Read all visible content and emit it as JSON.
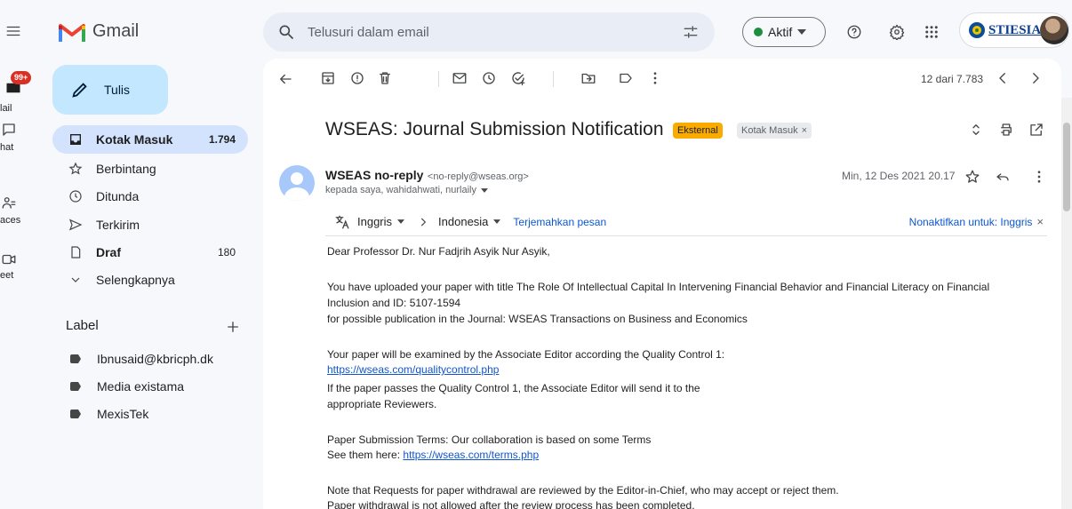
{
  "app": {
    "name": "Gmail"
  },
  "rail": {
    "badge": "99+",
    "items": [
      "Mail",
      "Chat",
      "Spaces",
      "Meet"
    ],
    "visible_labels": [
      "lail",
      "hat",
      "aces",
      "eet"
    ]
  },
  "compose": {
    "label": "Tulis"
  },
  "nav": [
    {
      "label": "Kotak Masuk",
      "count": "1.794",
      "icon": "inbox-icon",
      "active": true
    },
    {
      "label": "Berbintang",
      "count": "",
      "icon": "star-icon"
    },
    {
      "label": "Ditunda",
      "count": "",
      "icon": "clock-icon"
    },
    {
      "label": "Terkirim",
      "count": "",
      "icon": "send-icon"
    },
    {
      "label": "Draf",
      "count": "180",
      "icon": "draft-icon"
    },
    {
      "label": "Selengkapnya",
      "count": "",
      "icon": "chevron-down-icon"
    }
  ],
  "labels": {
    "heading": "Label",
    "items": [
      "Ibnusaid@kbricph.dk",
      "Media existama",
      "MexisTek"
    ]
  },
  "search": {
    "placeholder": "Telusuri dalam email"
  },
  "status": {
    "label": "Aktif",
    "color": "#1e8e3e"
  },
  "account": {
    "name": "STIESIA"
  },
  "toolbar": {
    "pager": "12 dari 7.783"
  },
  "email": {
    "subject": "WSEAS: Journal Submission Notification",
    "chip_external": "Eksternal",
    "chip_inbox": "Kotak Masuk",
    "chip_close": "×",
    "sender_name": "WSEAS no-reply",
    "sender_email": "<no-reply@wseas.org>",
    "recipients": "kepada saya, wahidahwati, nurlaily",
    "date": "Min, 12 Des 2021 20.17",
    "translate": {
      "from": "Inggris",
      "to": "Indonesia",
      "action": "Terjemahkan pesan",
      "disable": "Nonaktifkan untuk: Inggris",
      "close": "×"
    },
    "body": {
      "greeting": "Dear Professor Dr. Nur Fadjrih Asyik Nur Asyik,",
      "p1_l1": "You have uploaded your paper with title The Role Of Intellectual Capital In Intervening Financial Behavior and Financial Literacy on Financial",
      "p1_l2": "Inclusion and ID: 5107-1594",
      "p1_l3": "for possible publication in the Journal: WSEAS Transactions on Business and Economics",
      "p2_l1": "Your paper will be examined by the Associate Editor according the Quality Control 1:",
      "p2_link": "https://wseas.com/qualitycontrol.php",
      "p2_l3": "If the paper passes the Quality Control 1, the Associate Editor will send it to the",
      "p2_l4": "appropriate Reviewers.",
      "p3_l1": "Paper Submission Terms: Our collaboration is based on some Terms",
      "p3_l2_prefix": "See them here: ",
      "p3_link": "https://wseas.com/terms.php",
      "p4_l1": "Note that Requests for paper withdrawal are reviewed by the Editor-in-Chief, who may accept or reject them.",
      "p4_l2": "Paper withdrawal is not allowed after the review process has been completed."
    }
  },
  "colors": {
    "accent": "#0b57d0",
    "external_chip": "#f9ab00",
    "link": "#1155cc",
    "active_nav": "#d3e3fd",
    "compose": "#c2e7ff"
  }
}
